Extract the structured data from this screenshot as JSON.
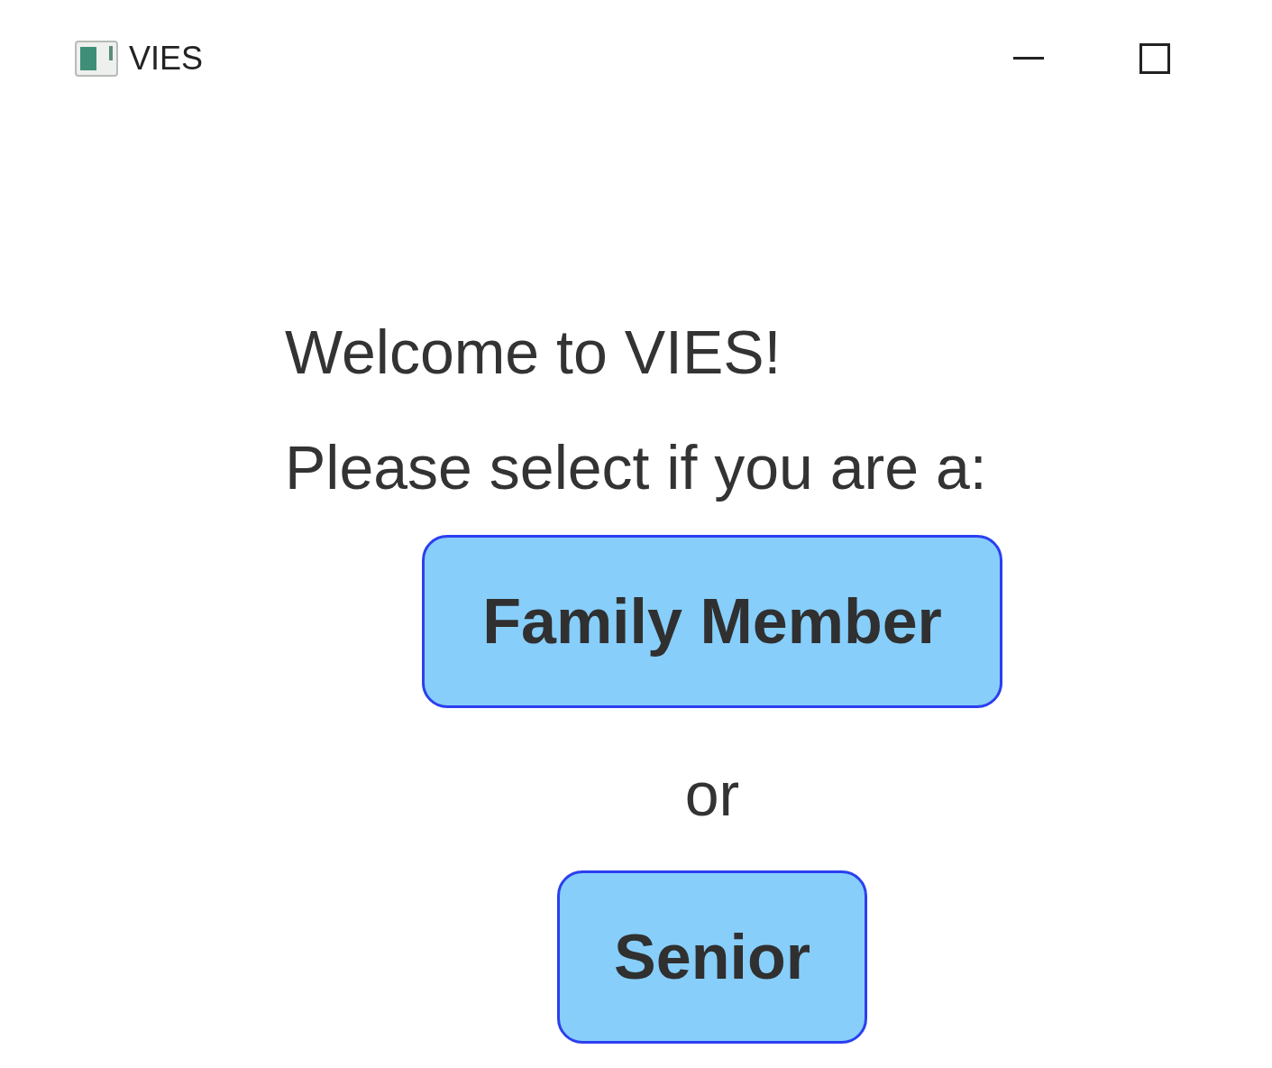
{
  "window": {
    "title": "VIES"
  },
  "welcome": "Welcome to VIES!",
  "prompt": "Please select if you are a:",
  "buttons": [
    {
      "label": "Family Member"
    },
    {
      "label": "Senior"
    }
  ],
  "separator": "or"
}
